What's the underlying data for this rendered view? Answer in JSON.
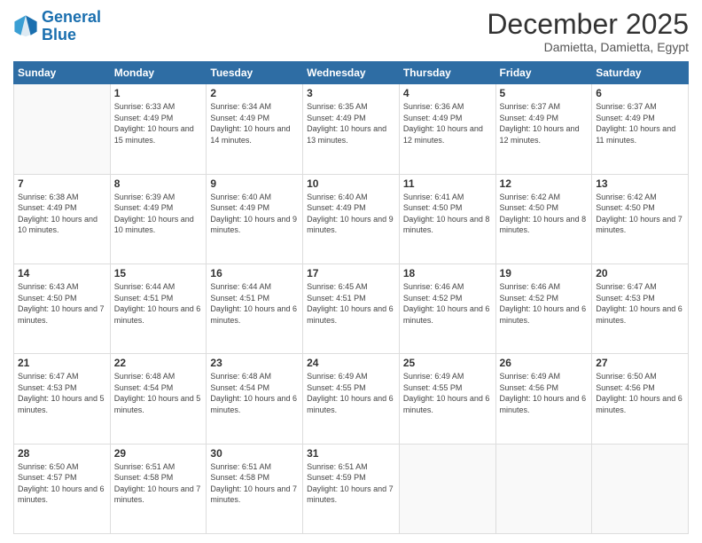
{
  "logo": {
    "line1": "General",
    "line2": "Blue"
  },
  "title": "December 2025",
  "location": "Damietta, Damietta, Egypt",
  "days_header": [
    "Sunday",
    "Monday",
    "Tuesday",
    "Wednesday",
    "Thursday",
    "Friday",
    "Saturday"
  ],
  "weeks": [
    [
      {
        "day": "",
        "info": ""
      },
      {
        "day": "1",
        "info": "Sunrise: 6:33 AM\nSunset: 4:49 PM\nDaylight: 10 hours and 15 minutes."
      },
      {
        "day": "2",
        "info": "Sunrise: 6:34 AM\nSunset: 4:49 PM\nDaylight: 10 hours and 14 minutes."
      },
      {
        "day": "3",
        "info": "Sunrise: 6:35 AM\nSunset: 4:49 PM\nDaylight: 10 hours and 13 minutes."
      },
      {
        "day": "4",
        "info": "Sunrise: 6:36 AM\nSunset: 4:49 PM\nDaylight: 10 hours and 12 minutes."
      },
      {
        "day": "5",
        "info": "Sunrise: 6:37 AM\nSunset: 4:49 PM\nDaylight: 10 hours and 12 minutes."
      },
      {
        "day": "6",
        "info": "Sunrise: 6:37 AM\nSunset: 4:49 PM\nDaylight: 10 hours and 11 minutes."
      }
    ],
    [
      {
        "day": "7",
        "info": "Sunrise: 6:38 AM\nSunset: 4:49 PM\nDaylight: 10 hours and 10 minutes."
      },
      {
        "day": "8",
        "info": "Sunrise: 6:39 AM\nSunset: 4:49 PM\nDaylight: 10 hours and 10 minutes."
      },
      {
        "day": "9",
        "info": "Sunrise: 6:40 AM\nSunset: 4:49 PM\nDaylight: 10 hours and 9 minutes."
      },
      {
        "day": "10",
        "info": "Sunrise: 6:40 AM\nSunset: 4:49 PM\nDaylight: 10 hours and 9 minutes."
      },
      {
        "day": "11",
        "info": "Sunrise: 6:41 AM\nSunset: 4:50 PM\nDaylight: 10 hours and 8 minutes."
      },
      {
        "day": "12",
        "info": "Sunrise: 6:42 AM\nSunset: 4:50 PM\nDaylight: 10 hours and 8 minutes."
      },
      {
        "day": "13",
        "info": "Sunrise: 6:42 AM\nSunset: 4:50 PM\nDaylight: 10 hours and 7 minutes."
      }
    ],
    [
      {
        "day": "14",
        "info": "Sunrise: 6:43 AM\nSunset: 4:50 PM\nDaylight: 10 hours and 7 minutes."
      },
      {
        "day": "15",
        "info": "Sunrise: 6:44 AM\nSunset: 4:51 PM\nDaylight: 10 hours and 6 minutes."
      },
      {
        "day": "16",
        "info": "Sunrise: 6:44 AM\nSunset: 4:51 PM\nDaylight: 10 hours and 6 minutes."
      },
      {
        "day": "17",
        "info": "Sunrise: 6:45 AM\nSunset: 4:51 PM\nDaylight: 10 hours and 6 minutes."
      },
      {
        "day": "18",
        "info": "Sunrise: 6:46 AM\nSunset: 4:52 PM\nDaylight: 10 hours and 6 minutes."
      },
      {
        "day": "19",
        "info": "Sunrise: 6:46 AM\nSunset: 4:52 PM\nDaylight: 10 hours and 6 minutes."
      },
      {
        "day": "20",
        "info": "Sunrise: 6:47 AM\nSunset: 4:53 PM\nDaylight: 10 hours and 6 minutes."
      }
    ],
    [
      {
        "day": "21",
        "info": "Sunrise: 6:47 AM\nSunset: 4:53 PM\nDaylight: 10 hours and 5 minutes."
      },
      {
        "day": "22",
        "info": "Sunrise: 6:48 AM\nSunset: 4:54 PM\nDaylight: 10 hours and 5 minutes."
      },
      {
        "day": "23",
        "info": "Sunrise: 6:48 AM\nSunset: 4:54 PM\nDaylight: 10 hours and 6 minutes."
      },
      {
        "day": "24",
        "info": "Sunrise: 6:49 AM\nSunset: 4:55 PM\nDaylight: 10 hours and 6 minutes."
      },
      {
        "day": "25",
        "info": "Sunrise: 6:49 AM\nSunset: 4:55 PM\nDaylight: 10 hours and 6 minutes."
      },
      {
        "day": "26",
        "info": "Sunrise: 6:49 AM\nSunset: 4:56 PM\nDaylight: 10 hours and 6 minutes."
      },
      {
        "day": "27",
        "info": "Sunrise: 6:50 AM\nSunset: 4:56 PM\nDaylight: 10 hours and 6 minutes."
      }
    ],
    [
      {
        "day": "28",
        "info": "Sunrise: 6:50 AM\nSunset: 4:57 PM\nDaylight: 10 hours and 6 minutes."
      },
      {
        "day": "29",
        "info": "Sunrise: 6:51 AM\nSunset: 4:58 PM\nDaylight: 10 hours and 7 minutes."
      },
      {
        "day": "30",
        "info": "Sunrise: 6:51 AM\nSunset: 4:58 PM\nDaylight: 10 hours and 7 minutes."
      },
      {
        "day": "31",
        "info": "Sunrise: 6:51 AM\nSunset: 4:59 PM\nDaylight: 10 hours and 7 minutes."
      },
      {
        "day": "",
        "info": ""
      },
      {
        "day": "",
        "info": ""
      },
      {
        "day": "",
        "info": ""
      }
    ]
  ]
}
